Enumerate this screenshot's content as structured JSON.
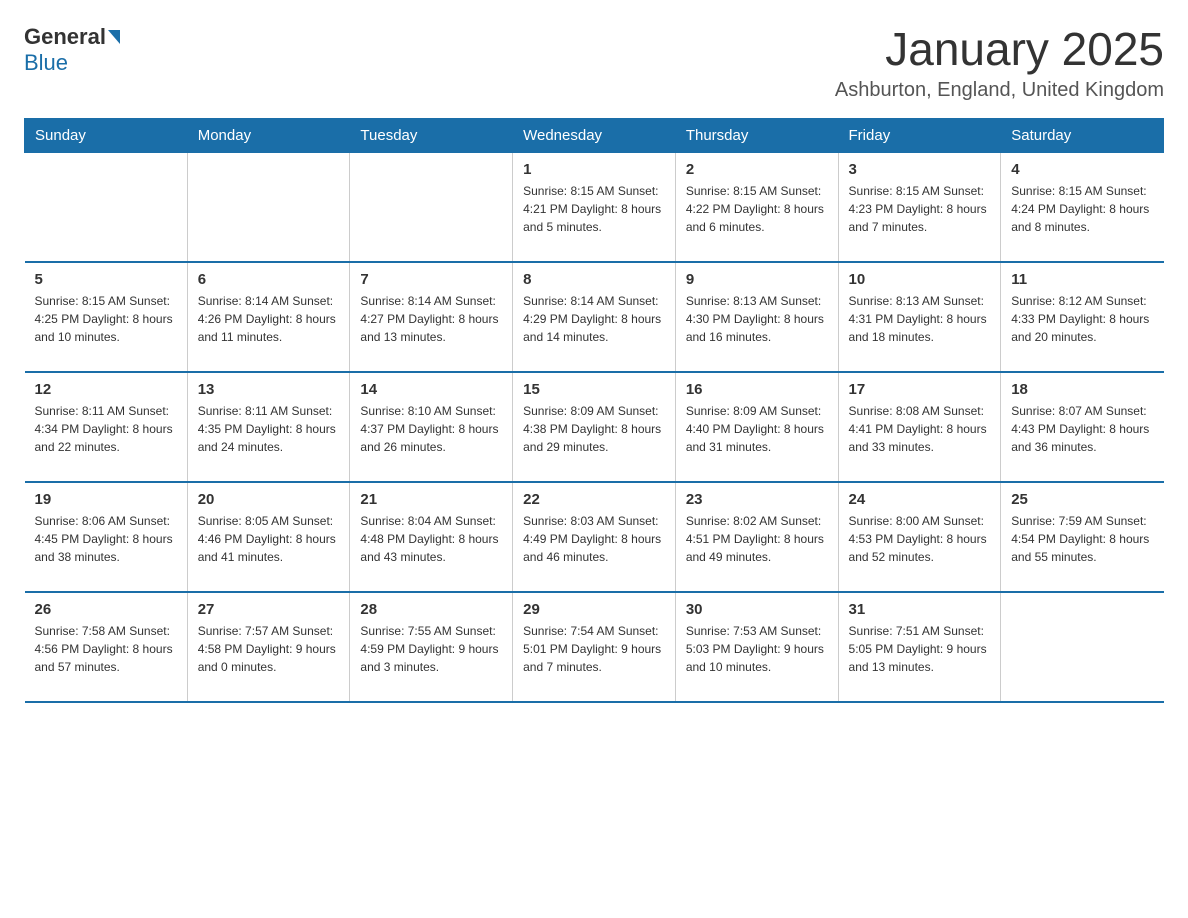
{
  "header": {
    "logo_general": "General",
    "logo_blue": "Blue",
    "month_title": "January 2025",
    "location": "Ashburton, England, United Kingdom"
  },
  "days_of_week": [
    "Sunday",
    "Monday",
    "Tuesday",
    "Wednesday",
    "Thursday",
    "Friday",
    "Saturday"
  ],
  "weeks": [
    [
      {
        "day": "",
        "info": ""
      },
      {
        "day": "",
        "info": ""
      },
      {
        "day": "",
        "info": ""
      },
      {
        "day": "1",
        "info": "Sunrise: 8:15 AM\nSunset: 4:21 PM\nDaylight: 8 hours\nand 5 minutes."
      },
      {
        "day": "2",
        "info": "Sunrise: 8:15 AM\nSunset: 4:22 PM\nDaylight: 8 hours\nand 6 minutes."
      },
      {
        "day": "3",
        "info": "Sunrise: 8:15 AM\nSunset: 4:23 PM\nDaylight: 8 hours\nand 7 minutes."
      },
      {
        "day": "4",
        "info": "Sunrise: 8:15 AM\nSunset: 4:24 PM\nDaylight: 8 hours\nand 8 minutes."
      }
    ],
    [
      {
        "day": "5",
        "info": "Sunrise: 8:15 AM\nSunset: 4:25 PM\nDaylight: 8 hours\nand 10 minutes."
      },
      {
        "day": "6",
        "info": "Sunrise: 8:14 AM\nSunset: 4:26 PM\nDaylight: 8 hours\nand 11 minutes."
      },
      {
        "day": "7",
        "info": "Sunrise: 8:14 AM\nSunset: 4:27 PM\nDaylight: 8 hours\nand 13 minutes."
      },
      {
        "day": "8",
        "info": "Sunrise: 8:14 AM\nSunset: 4:29 PM\nDaylight: 8 hours\nand 14 minutes."
      },
      {
        "day": "9",
        "info": "Sunrise: 8:13 AM\nSunset: 4:30 PM\nDaylight: 8 hours\nand 16 minutes."
      },
      {
        "day": "10",
        "info": "Sunrise: 8:13 AM\nSunset: 4:31 PM\nDaylight: 8 hours\nand 18 minutes."
      },
      {
        "day": "11",
        "info": "Sunrise: 8:12 AM\nSunset: 4:33 PM\nDaylight: 8 hours\nand 20 minutes."
      }
    ],
    [
      {
        "day": "12",
        "info": "Sunrise: 8:11 AM\nSunset: 4:34 PM\nDaylight: 8 hours\nand 22 minutes."
      },
      {
        "day": "13",
        "info": "Sunrise: 8:11 AM\nSunset: 4:35 PM\nDaylight: 8 hours\nand 24 minutes."
      },
      {
        "day": "14",
        "info": "Sunrise: 8:10 AM\nSunset: 4:37 PM\nDaylight: 8 hours\nand 26 minutes."
      },
      {
        "day": "15",
        "info": "Sunrise: 8:09 AM\nSunset: 4:38 PM\nDaylight: 8 hours\nand 29 minutes."
      },
      {
        "day": "16",
        "info": "Sunrise: 8:09 AM\nSunset: 4:40 PM\nDaylight: 8 hours\nand 31 minutes."
      },
      {
        "day": "17",
        "info": "Sunrise: 8:08 AM\nSunset: 4:41 PM\nDaylight: 8 hours\nand 33 minutes."
      },
      {
        "day": "18",
        "info": "Sunrise: 8:07 AM\nSunset: 4:43 PM\nDaylight: 8 hours\nand 36 minutes."
      }
    ],
    [
      {
        "day": "19",
        "info": "Sunrise: 8:06 AM\nSunset: 4:45 PM\nDaylight: 8 hours\nand 38 minutes."
      },
      {
        "day": "20",
        "info": "Sunrise: 8:05 AM\nSunset: 4:46 PM\nDaylight: 8 hours\nand 41 minutes."
      },
      {
        "day": "21",
        "info": "Sunrise: 8:04 AM\nSunset: 4:48 PM\nDaylight: 8 hours\nand 43 minutes."
      },
      {
        "day": "22",
        "info": "Sunrise: 8:03 AM\nSunset: 4:49 PM\nDaylight: 8 hours\nand 46 minutes."
      },
      {
        "day": "23",
        "info": "Sunrise: 8:02 AM\nSunset: 4:51 PM\nDaylight: 8 hours\nand 49 minutes."
      },
      {
        "day": "24",
        "info": "Sunrise: 8:00 AM\nSunset: 4:53 PM\nDaylight: 8 hours\nand 52 minutes."
      },
      {
        "day": "25",
        "info": "Sunrise: 7:59 AM\nSunset: 4:54 PM\nDaylight: 8 hours\nand 55 minutes."
      }
    ],
    [
      {
        "day": "26",
        "info": "Sunrise: 7:58 AM\nSunset: 4:56 PM\nDaylight: 8 hours\nand 57 minutes."
      },
      {
        "day": "27",
        "info": "Sunrise: 7:57 AM\nSunset: 4:58 PM\nDaylight: 9 hours\nand 0 minutes."
      },
      {
        "day": "28",
        "info": "Sunrise: 7:55 AM\nSunset: 4:59 PM\nDaylight: 9 hours\nand 3 minutes."
      },
      {
        "day": "29",
        "info": "Sunrise: 7:54 AM\nSunset: 5:01 PM\nDaylight: 9 hours\nand 7 minutes."
      },
      {
        "day": "30",
        "info": "Sunrise: 7:53 AM\nSunset: 5:03 PM\nDaylight: 9 hours\nand 10 minutes."
      },
      {
        "day": "31",
        "info": "Sunrise: 7:51 AM\nSunset: 5:05 PM\nDaylight: 9 hours\nand 13 minutes."
      },
      {
        "day": "",
        "info": ""
      }
    ]
  ]
}
